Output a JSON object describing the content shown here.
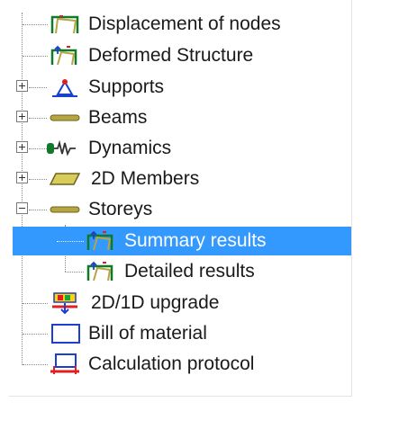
{
  "tree": {
    "items": [
      {
        "label": "Displacement of nodes",
        "icon": "structure-displacement-icon",
        "expander": "none"
      },
      {
        "label": "Deformed Structure",
        "icon": "deformed-structure-icon",
        "expander": "none"
      },
      {
        "label": "Supports",
        "icon": "support-icon",
        "expander": "plus"
      },
      {
        "label": "Beams",
        "icon": "beam-icon",
        "expander": "plus"
      },
      {
        "label": "Dynamics",
        "icon": "dynamics-icon",
        "expander": "plus"
      },
      {
        "label": "2D Members",
        "icon": "plate-icon",
        "expander": "plus"
      },
      {
        "label": "Storeys",
        "icon": "storey-icon",
        "expander": "minus"
      },
      {
        "label": "Summary results",
        "icon": "summary-results-icon",
        "selected": true,
        "child": true
      },
      {
        "label": "Detailed results",
        "icon": "detailed-results-icon",
        "child": true
      },
      {
        "label": "2D/1D upgrade",
        "icon": "upgrade-icon",
        "expander": "none"
      },
      {
        "label": "Bill of material",
        "icon": "bill-of-material-icon",
        "expander": "none"
      },
      {
        "label": "Calculation protocol",
        "icon": "calculation-protocol-icon",
        "expander": "none"
      }
    ]
  },
  "colors": {
    "selection": "#3399ff",
    "beam": "#b5a642",
    "frame": "#0f7a2a",
    "accent_red": "#e02020",
    "accent_blue": "#1a3fd1"
  }
}
